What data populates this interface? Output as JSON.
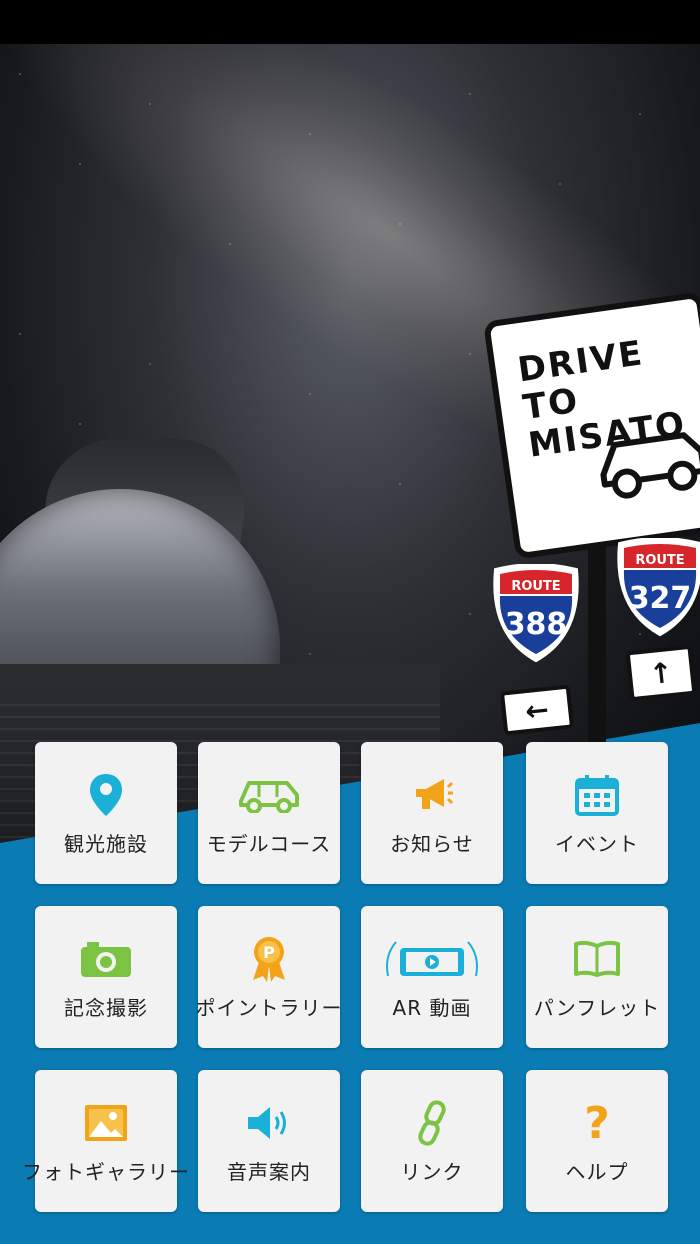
{
  "hero": {
    "sign_line1": "DRIVE TO",
    "sign_line2": "MISATO",
    "route_left_label": "ROUTE",
    "route_left_number": "388",
    "route_right_label": "ROUTE",
    "route_right_number": "327"
  },
  "menu": {
    "items": [
      {
        "label": "観光施設",
        "icon": "map-pin-icon",
        "color": "#1ab0d8"
      },
      {
        "label": "モデルコース",
        "icon": "car-icon",
        "color": "#7cc243"
      },
      {
        "label": "お知らせ",
        "icon": "megaphone-icon",
        "color": "#f2a31a"
      },
      {
        "label": "イベント",
        "icon": "calendar-icon",
        "color": "#1ab0d8"
      },
      {
        "label": "記念撮影",
        "icon": "camera-icon",
        "color": "#7cc243"
      },
      {
        "label": "ポイントラリー",
        "icon": "medal-icon",
        "color": "#f2a31a"
      },
      {
        "label": "AR 動画",
        "icon": "ar-phone-icon",
        "color": "#1ab0d8"
      },
      {
        "label": "パンフレット",
        "icon": "book-icon",
        "color": "#7cc243"
      },
      {
        "label": "フォトギャラリー",
        "icon": "image-icon",
        "color": "#f2a31a"
      },
      {
        "label": "音声案内",
        "icon": "speaker-icon",
        "color": "#1ab0d8"
      },
      {
        "label": "リンク",
        "icon": "link-icon",
        "color": "#7cc243"
      },
      {
        "label": "ヘルプ",
        "icon": "help-icon",
        "color": "#f2a31a"
      }
    ]
  },
  "colors": {
    "brand_blue": "#0a7bb3",
    "shield_blue": "#1a3f9a",
    "shield_red": "#d7262b"
  }
}
